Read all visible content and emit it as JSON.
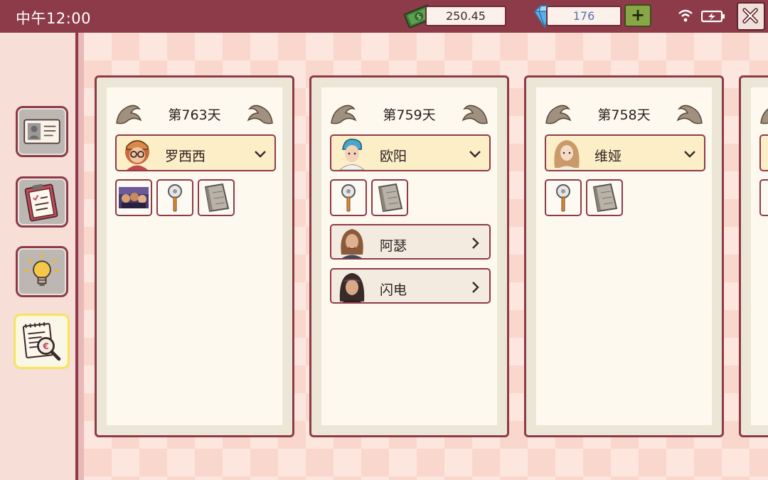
{
  "status_bar": {
    "time": "中午12:00",
    "money": "250.45",
    "gems": "176"
  },
  "sidebar": {
    "items": [
      {
        "name": "id-card"
      },
      {
        "name": "clipboard"
      },
      {
        "name": "lightbulb"
      },
      {
        "name": "investigation",
        "active": true
      }
    ]
  },
  "cards": [
    {
      "day": "第763天",
      "main_person": {
        "name": "罗西西"
      },
      "clues": [
        "photo",
        "pizza-cutter",
        "stone-tablet"
      ],
      "related": []
    },
    {
      "day": "第759天",
      "main_person": {
        "name": "欧阳"
      },
      "clues": [
        "pizza-cutter",
        "stone-tablet"
      ],
      "related": [
        {
          "name": "阿瑟"
        },
        {
          "name": "闪电"
        }
      ]
    },
    {
      "day": "第758天",
      "main_person": {
        "name": "维娅"
      },
      "clues": [
        "pizza-cutter",
        "stone-tablet"
      ],
      "related": []
    }
  ],
  "colors": {
    "accent": "#8e3b49",
    "card_bg": "#fdf9ee",
    "row_highlight": "#fcefc7",
    "add_button": "#88a646"
  }
}
